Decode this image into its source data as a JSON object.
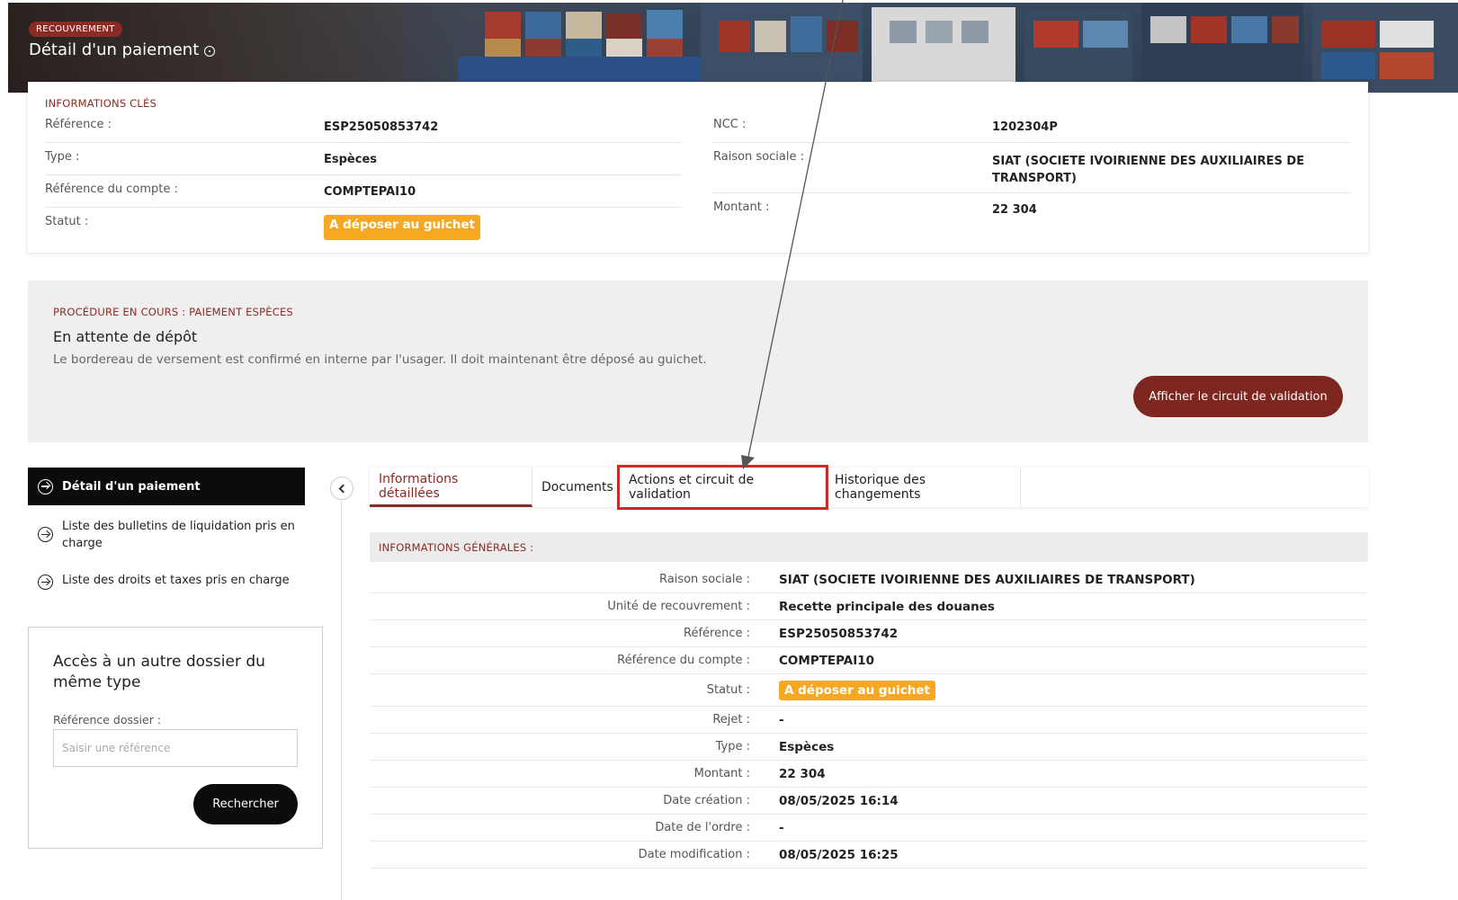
{
  "hero": {
    "badge": "RECOUVREMENT",
    "title": "Détail d'un paiement"
  },
  "key_info": {
    "section_title": "INFORMATIONS CLÉS",
    "left": [
      {
        "label": "Référence :",
        "value": "ESP25050853742"
      },
      {
        "label": "Type :",
        "value": "Espèces"
      },
      {
        "label": "Référence du compte :",
        "value": "COMPTEPAI10"
      },
      {
        "label": "Statut :",
        "value": "A déposer au guichet"
      }
    ],
    "right": [
      {
        "label": "NCC :",
        "value": "1202304P"
      },
      {
        "label": "Raison sociale :",
        "value": "SIAT (SOCIETE IVOIRIENNE DES AUXILIAIRES DE TRANSPORT)"
      },
      {
        "label": "Montant :",
        "value": "22 304"
      }
    ]
  },
  "procedure": {
    "section_title": "PROCÉDURE EN COURS : PAIEMENT ESPÈCES",
    "title": "En attente de dépôt",
    "description": "Le bordereau de versement est confirmé en interne par l'usager. Il doit maintenant être déposé au guichet.",
    "button_label": "Afficher le circuit de validation"
  },
  "sidebar": {
    "items": [
      {
        "label": "Détail d'un paiement"
      },
      {
        "label": "Liste des bulletins de liquidation pris en charge"
      },
      {
        "label": "Liste des droits et taxes pris en charge"
      }
    ]
  },
  "search_card": {
    "title": "Accès à un autre dossier du même type",
    "field_label": "Référence dossier :",
    "placeholder": "Saisir une référence",
    "button_label": "Rechercher"
  },
  "tabs": [
    {
      "label": "Informations détaillées"
    },
    {
      "label": "Documents"
    },
    {
      "label": "Actions et circuit de validation"
    },
    {
      "label": "Historique des changements"
    }
  ],
  "general_info": {
    "section_title": "INFORMATIONS GÉNÉRALES :",
    "rows": [
      {
        "label": "Raison sociale :",
        "value": "SIAT (SOCIETE IVOIRIENNE DES AUXILIAIRES DE TRANSPORT)"
      },
      {
        "label": "Unité de recouvrement :",
        "value": "Recette principale des douanes"
      },
      {
        "label": "Référence :",
        "value": "ESP25050853742"
      },
      {
        "label": "Référence du compte :",
        "value": "COMPTEPAI10"
      },
      {
        "label": "Statut :",
        "value": "A déposer au guichet"
      },
      {
        "label": "Rejet :",
        "value": "-"
      },
      {
        "label": "Type :",
        "value": "Espèces"
      },
      {
        "label": "Montant :",
        "value": "22 304"
      },
      {
        "label": "Date création :",
        "value": "08/05/2025 16:14"
      },
      {
        "label": "Date de l'ordre :",
        "value": "-"
      },
      {
        "label": "Date modification :",
        "value": "08/05/2025 16:25"
      }
    ]
  },
  "colors": {
    "brand": "#8c2a24",
    "status_orange": "#f7a823",
    "highlight_red": "#c92b2b"
  }
}
